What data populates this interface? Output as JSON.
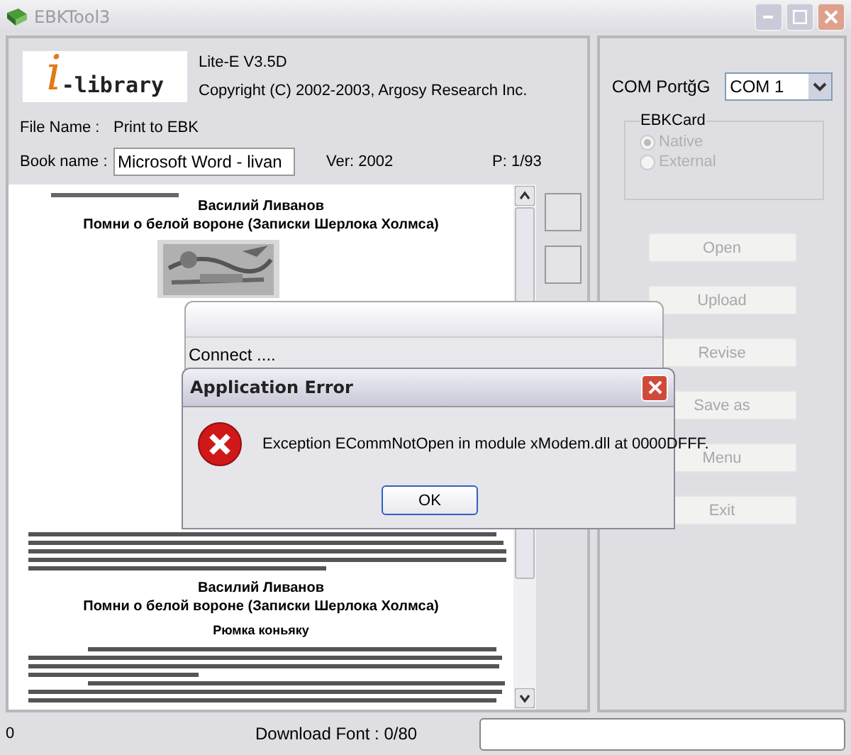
{
  "window": {
    "title": "EBKTool3"
  },
  "header": {
    "logo_mark": "i",
    "logo_text": "-library",
    "version": "Lite-E V3.5D",
    "copyright": "Copyright (C) 2002-2003, Argosy Research Inc."
  },
  "file_name": {
    "label": "File Name :",
    "value": "Print to EBK"
  },
  "book_name": {
    "label": "Book name :",
    "value": "Microsoft Word - livan"
  },
  "ver": "Ver: 2002",
  "page": "P: 1/93",
  "preview": {
    "author": "Василий Ливанов",
    "title": "Помни о белой вороне (Записки Шерлока Холмса)",
    "author_2": "Василий Ливанов",
    "title_2": "Помни о белой вороне (Записки Шерлока Холмса)",
    "chapter": "Рюмка коньяку"
  },
  "com_port": {
    "label": "COM PortğG",
    "value": "COM 1"
  },
  "ebk_card": {
    "label": "EBKCard",
    "disabled": true,
    "options": [
      {
        "label": "Native",
        "selected": true
      },
      {
        "label": "External",
        "selected": false
      }
    ]
  },
  "buttons": [
    {
      "label": "Open",
      "disabled": true
    },
    {
      "label": "Upload",
      "disabled": true
    },
    {
      "label": "Revise",
      "disabled": true
    },
    {
      "label": "Save as",
      "disabled": true
    },
    {
      "label": "Menu",
      "disabled": true
    },
    {
      "label": "Exit",
      "disabled": true
    }
  ],
  "status_bar": {
    "count": "0",
    "download": "Download Font : 0/80"
  },
  "connect_dialog": {
    "message": "Connect ...."
  },
  "error_dialog": {
    "title": "Application Error",
    "message": "Exception ECommNotOpen in module xModem.dll at 0000DFFF.",
    "button": "OK"
  }
}
